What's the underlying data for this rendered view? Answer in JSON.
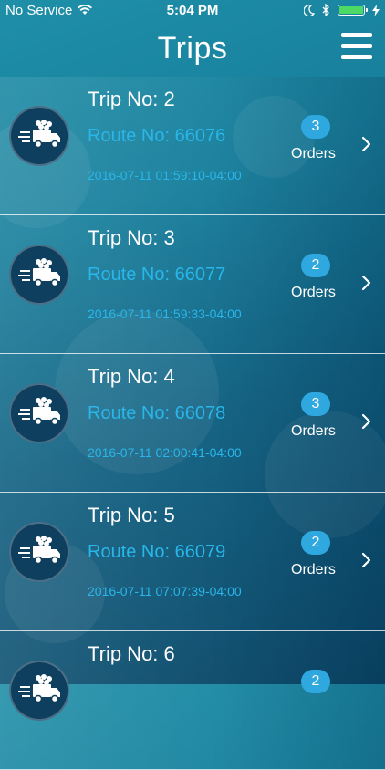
{
  "status_bar": {
    "carrier": "No Service",
    "time": "5:04 PM"
  },
  "header": {
    "title": "Trips"
  },
  "trips": [
    {
      "trip_no": "Trip No: 2",
      "route_no": "Route No: 66076",
      "timestamp": "2016-07-11 01:59:10-04:00",
      "order_count": "3",
      "orders_label": "Orders"
    },
    {
      "trip_no": "Trip No: 3",
      "route_no": "Route No: 66077",
      "timestamp": "2016-07-11 01:59:33-04:00",
      "order_count": "2",
      "orders_label": "Orders"
    },
    {
      "trip_no": "Trip No: 4",
      "route_no": "Route No: 66078",
      "timestamp": "2016-07-11 02:00:41-04:00",
      "order_count": "3",
      "orders_label": "Orders"
    },
    {
      "trip_no": "Trip No: 5",
      "route_no": "Route No: 66079",
      "timestamp": "2016-07-11 07:07:39-04:00",
      "order_count": "2",
      "orders_label": "Orders"
    },
    {
      "trip_no": "Trip No: 6",
      "route_no": "",
      "timestamp": "",
      "order_count": "2",
      "orders_label": ""
    }
  ],
  "colors": {
    "accent": "#29b6ea",
    "badge": "#2fa8e0",
    "battery": "#4cd964",
    "avatar_bg": "#0f3f5e"
  },
  "icons": {
    "wifi": "wifi-icon",
    "moon": "moon-icon",
    "bluetooth": "bluetooth-icon",
    "battery": "battery-icon",
    "menu": "hamburger-menu-icon",
    "truck": "delivery-truck-icon",
    "chevron": "chevron-right-icon"
  }
}
